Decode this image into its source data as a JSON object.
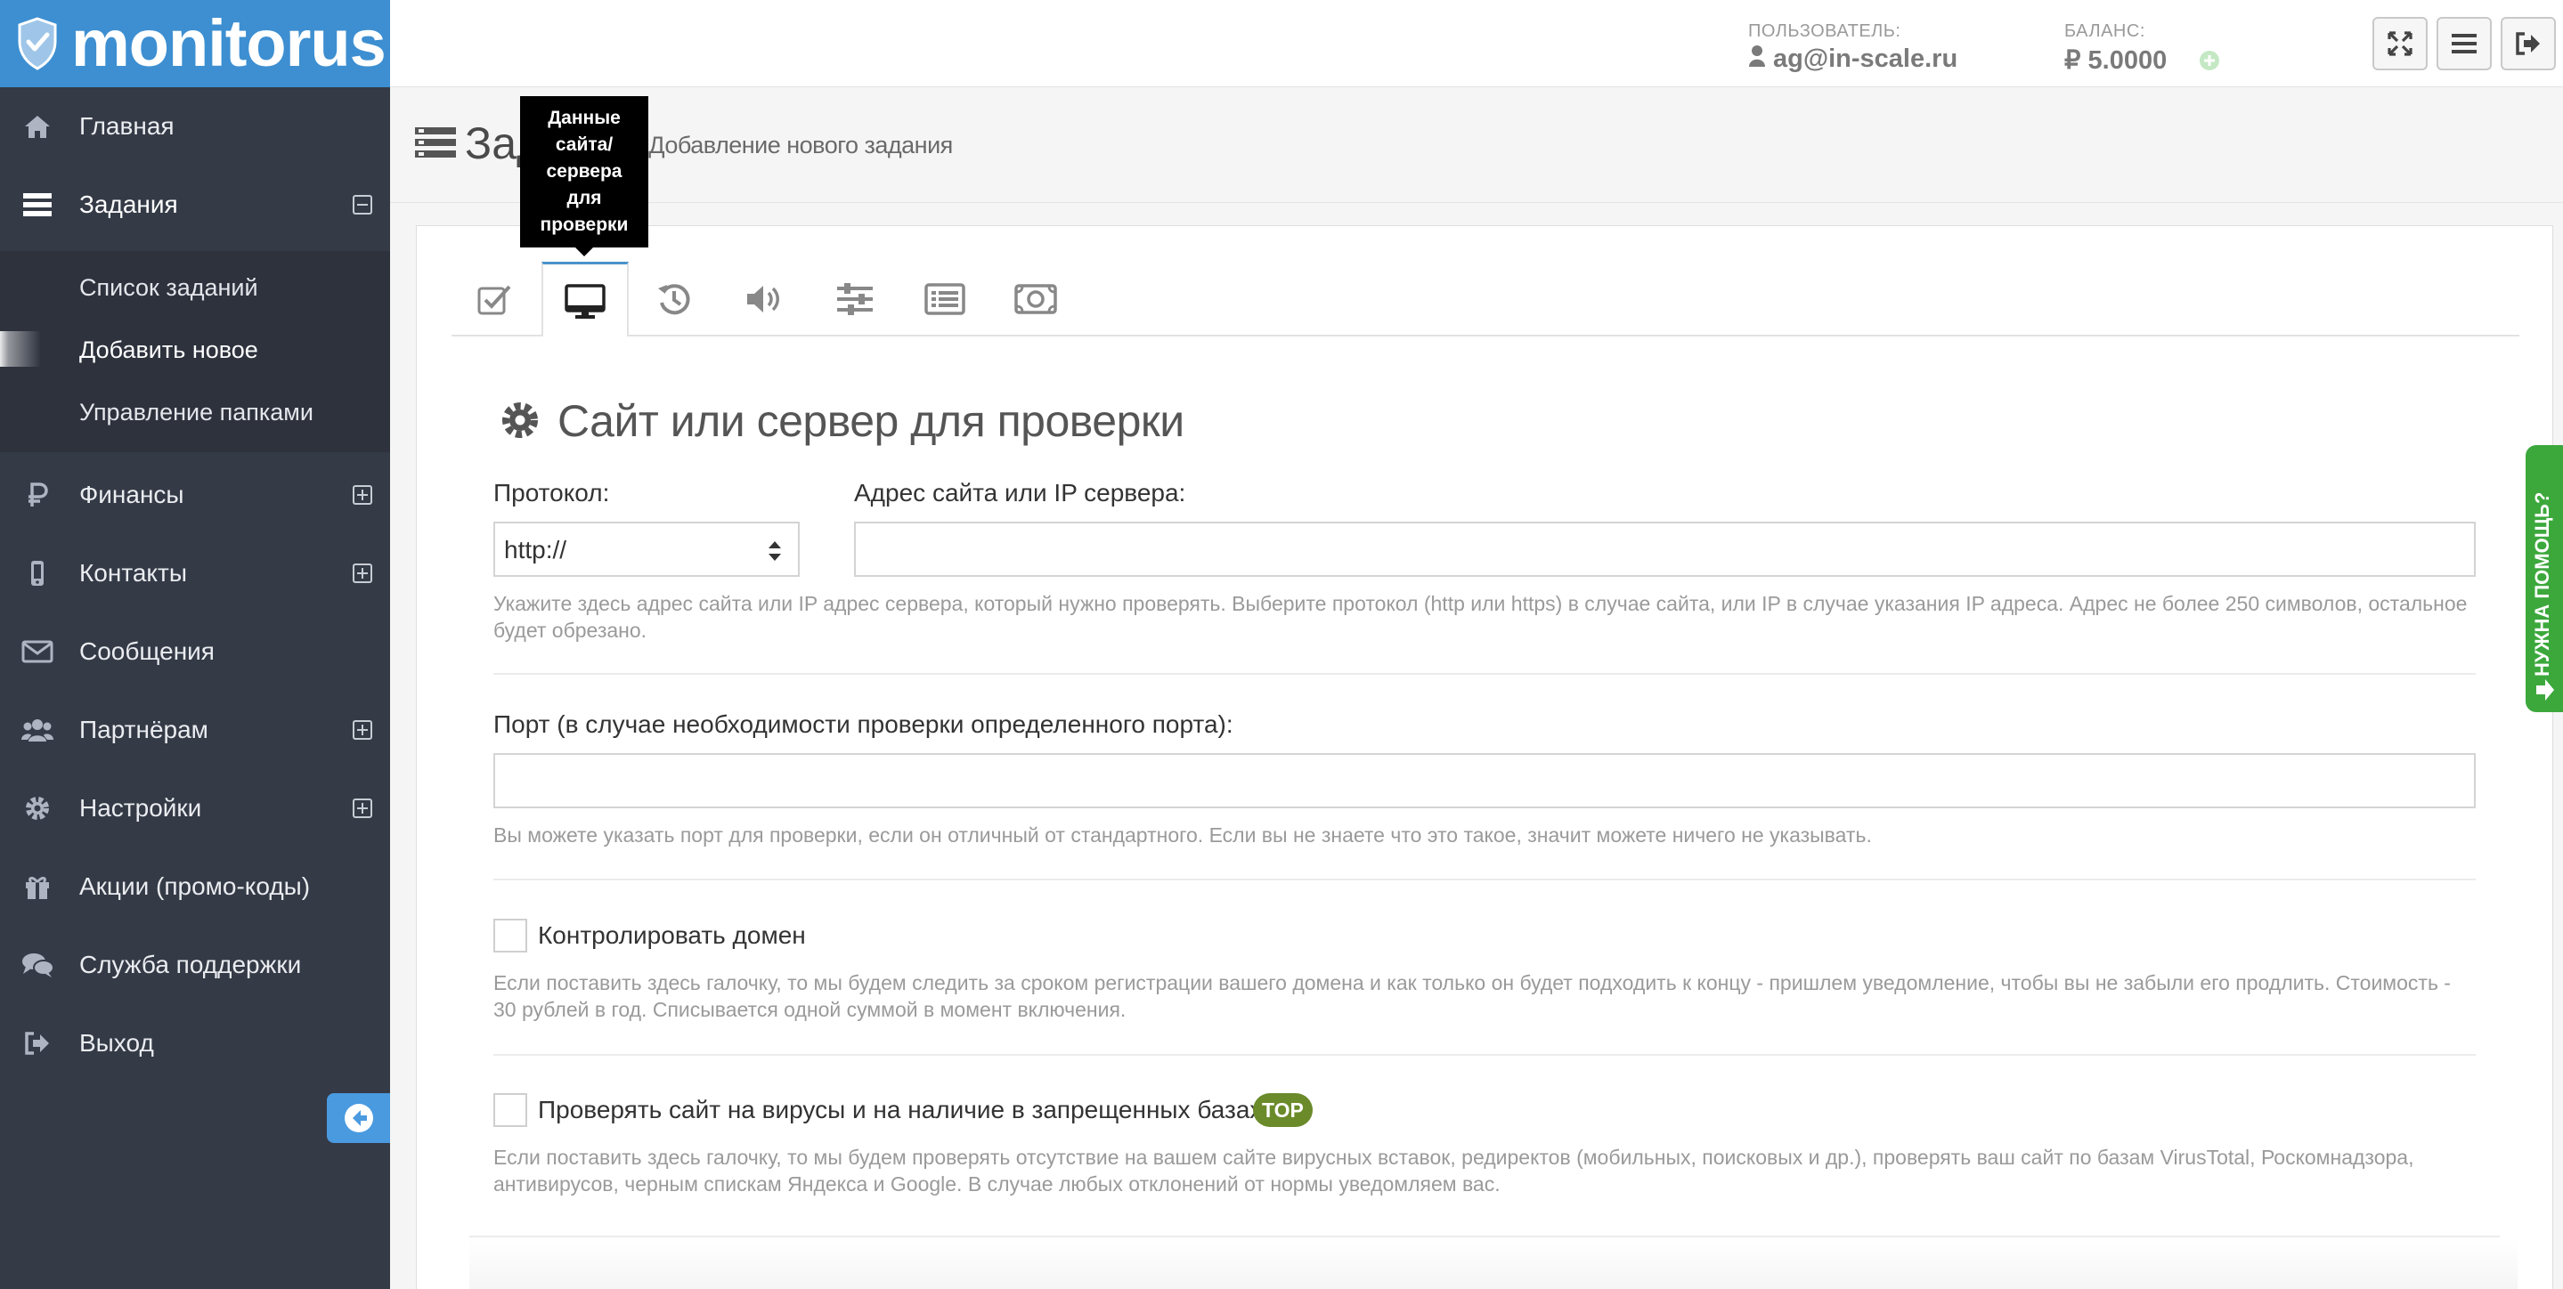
{
  "app": {
    "brand": "monitorus",
    "brand_color": "#3d8fd1",
    "sidebar_color": "#343a46"
  },
  "sidebar": {
    "items": [
      {
        "label": "Главная",
        "icon": "home-icon"
      },
      {
        "label": "Задания",
        "icon": "tasks-icon",
        "toggle": "collapse"
      },
      {
        "label": "Финансы",
        "icon": "ruble-icon",
        "toggle": "expand"
      },
      {
        "label": "Контакты",
        "icon": "mobile-icon",
        "toggle": "expand"
      },
      {
        "label": "Сообщения",
        "icon": "envelope-icon"
      },
      {
        "label": "Партнёрам",
        "icon": "users-icon",
        "toggle": "expand"
      },
      {
        "label": "Настройки",
        "icon": "gear-icon",
        "toggle": "expand"
      },
      {
        "label": "Акции (промо-коды)",
        "icon": "gift-icon"
      },
      {
        "label": "Служба поддержки",
        "icon": "chat-icon"
      },
      {
        "label": "Выход",
        "icon": "sign-out-icon"
      }
    ],
    "submenu": [
      {
        "label": "Список заданий"
      },
      {
        "label": "Добавить новое",
        "active": true
      },
      {
        "label": "Управление папками"
      }
    ]
  },
  "header": {
    "user_label": "ПОЛЬЗОВАТЕЛЬ:",
    "user_value": "ag@in-scale.ru",
    "balance_label": "БАЛАНС:",
    "balance_value": "₽ 5.0000",
    "buttons": [
      "fullscreen-icon",
      "menu-icon",
      "sign-out-icon"
    ]
  },
  "breadcrumb": {
    "title": "Зада",
    "crumb": "> Добавление нового задания"
  },
  "tooltip": {
    "text": [
      "Данные",
      "сайта/",
      "сервера",
      "для",
      "проверки"
    ]
  },
  "tabs": [
    {
      "icon": "check-square-icon"
    },
    {
      "icon": "desktop-icon",
      "active": true
    },
    {
      "icon": "history-icon"
    },
    {
      "icon": "volume-icon"
    },
    {
      "icon": "sliders-icon"
    },
    {
      "icon": "list-icon"
    },
    {
      "icon": "money-icon"
    }
  ],
  "form": {
    "section_title": "Сайт или сервер для проверки",
    "protocol_label": "Протокол:",
    "protocol_value": "http://",
    "address_label": "Адрес сайта или IP сервера:",
    "address_value": "",
    "address_help_1": "Укажите здесь адрес сайта или IP адрес сервера, который нужно проверять. Выберите протокол (http или https) в случае сайта, или IP в случае указания IP адреса. Адрес не более 250 символов, остальное",
    "address_help_2": "будет обрезано.",
    "port_label": "Порт (в случае необходимости проверки определенного порта):",
    "port_value": "",
    "port_help": "Вы можете указать порт для проверки, если он отличный от стандартного. Если вы не знаете что это такое, значит можете ничего не указывать.",
    "domain_label": "Контролировать домен",
    "domain_checked": false,
    "domain_help_1": "Если поставить здесь галочку, то мы будем следить за сроком регистрации вашего домена и как только он будет подходить к концу - пришлем уведомление, чтобы вы не забыли его продлить. Стоимость -",
    "domain_help_2": "30 рублей в год. Списывается одной суммой в момент включения.",
    "virus_label": "Проверять сайт на вирусы и на наличие в запрещенных базах",
    "virus_checked": false,
    "virus_badge": "TOP",
    "virus_help_1": "Если поставить здесь галочку, то мы будем проверять отсутствие на вашем сайте вирусных вставок, редиректов (мобильных, поисковых и др.), проверять ваш сайт по базам VirusTotal, Роскомнадзора,",
    "virus_help_2": "антивирусов, черным спискам Яндекса и Google. В случае любых отклонений от нормы уведомляем вас."
  },
  "help_tab": {
    "label": "НУЖНА ПОМОЩЬ?",
    "color": "#3ca83c"
  }
}
